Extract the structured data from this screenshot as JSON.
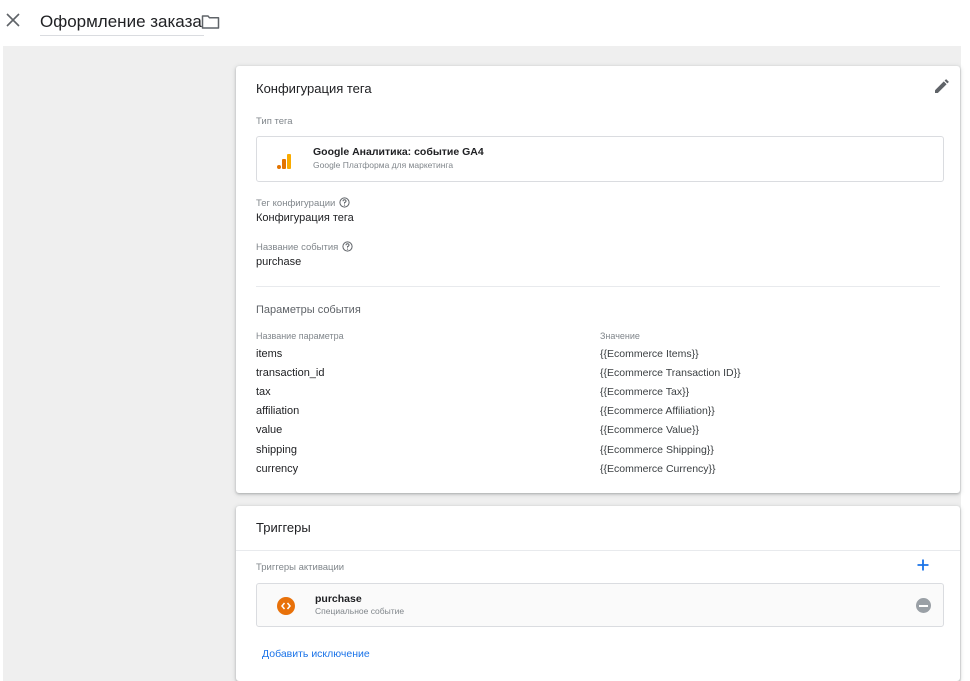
{
  "header": {
    "close_icon": "close-icon",
    "title": "Оформление заказа",
    "folder_icon": "folder-icon"
  },
  "tag_config": {
    "title": "Конфигурация тега",
    "edit_icon": "pencil-icon",
    "tag_type_label": "Тип тега",
    "tag_type_name": "Google Аналитика: событие GA4",
    "tag_type_sub": "Google Платформа для маркетинга",
    "config_tag_label": "Тег конфигурации",
    "config_tag_value": "Конфигурация тега",
    "event_name_label": "Название события",
    "event_name_value": "purchase",
    "params_title": "Параметры события",
    "col_param_name": "Название параметра",
    "col_value": "Значение",
    "params": [
      {
        "name": "items",
        "value": "{{Ecommerce Items}}"
      },
      {
        "name": "transaction_id",
        "value": "{{Ecommerce Transaction ID}}"
      },
      {
        "name": "tax",
        "value": "{{Ecommerce Tax}}"
      },
      {
        "name": "affiliation",
        "value": "{{Ecommerce Affiliation}}"
      },
      {
        "name": "value",
        "value": "{{Ecommerce Value}}"
      },
      {
        "name": "shipping",
        "value": "{{Ecommerce Shipping}}"
      },
      {
        "name": "currency",
        "value": "{{Ecommerce Currency}}"
      }
    ]
  },
  "triggers": {
    "title": "Триггеры",
    "firing_label": "Триггеры активации",
    "add_icon": "plus-icon",
    "trigger_name": "purchase",
    "trigger_sub": "Специальное событие",
    "add_exception": "Добавить исключение"
  },
  "colors": {
    "accent": "#1a73e8",
    "trigger_orange": "#e8710a",
    "ga_orange": "#f9ab00",
    "ga_dark_orange": "#e37400",
    "canvas_gray": "#efefef"
  }
}
